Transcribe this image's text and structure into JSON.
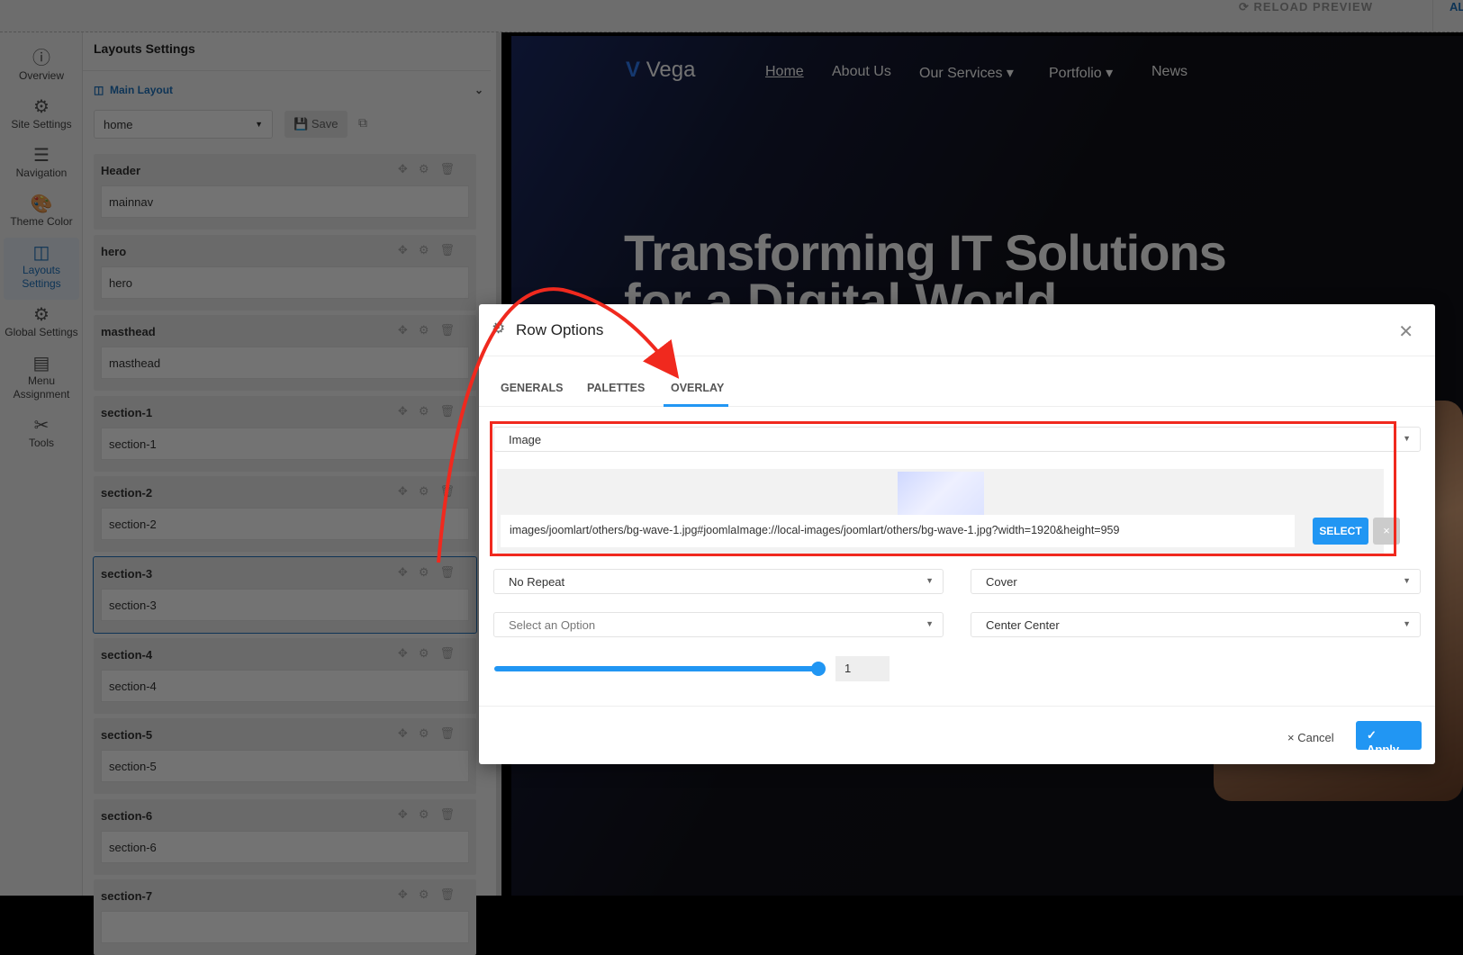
{
  "topbar": {
    "reload": "RELOAD PREVIEW",
    "right_link": "AL"
  },
  "nav": [
    {
      "icon": "info-icon",
      "glyph": "ⓘ",
      "label": "Overview"
    },
    {
      "icon": "gear-icon",
      "glyph": "⚙",
      "label": "Site Settings"
    },
    {
      "icon": "menu-icon",
      "glyph": "☰",
      "label": "Navigation"
    },
    {
      "icon": "palette-icon",
      "glyph": "🎨",
      "label": "Theme Color"
    },
    {
      "icon": "layout-icon",
      "glyph": "◫",
      "label": "Layouts Settings"
    },
    {
      "icon": "gears-icon",
      "glyph": "⚙",
      "label": "Global Settings"
    },
    {
      "icon": "list-icon",
      "glyph": "▤",
      "label": "Menu Assignment"
    },
    {
      "icon": "tools-icon",
      "glyph": "✂",
      "label": "Tools"
    }
  ],
  "panel": {
    "title": "Layouts Settings",
    "layout_name": "Main Layout",
    "layout_select": "home",
    "save": "Save",
    "blocks": [
      {
        "name": "Header",
        "value": "mainnav"
      },
      {
        "name": "hero",
        "value": "hero"
      },
      {
        "name": "masthead",
        "value": "masthead"
      },
      {
        "name": "section-1",
        "value": "section-1"
      },
      {
        "name": "section-2",
        "value": "section-2"
      },
      {
        "name": "section-3",
        "value": "section-3"
      },
      {
        "name": "section-4",
        "value": "section-4"
      },
      {
        "name": "section-5",
        "value": "section-5"
      },
      {
        "name": "section-6",
        "value": "section-6"
      },
      {
        "name": "section-7",
        "value": ""
      }
    ]
  },
  "preview": {
    "logo": "Vega",
    "nav": [
      "Home",
      "About Us",
      "Our Services ▾",
      "Portfolio ▾",
      "News"
    ],
    "hero_line1": "Transforming IT Solutions",
    "hero_line2": "for a Digital World"
  },
  "modal": {
    "title": "Row Options",
    "tabs": [
      "GENERALS",
      "PALETTES",
      "OVERLAY"
    ],
    "active_tab": "OVERLAY",
    "overlay_type": "Image",
    "image_path": "images/joomlart/others/bg-wave-1.jpg#joomlaImage://local-images/joomlart/others/bg-wave-1.jpg?width=1920&height=959",
    "select_btn": "SELECT",
    "clear_btn": "×",
    "repeat": "No Repeat",
    "size": "Cover",
    "attachment_placeholder": "Select an Option",
    "position": "Center Center",
    "opacity": "1",
    "cancel": "× Cancel",
    "apply": "✓ Apply"
  },
  "colors": {
    "accent": "#2196f3",
    "annotation": "#f0291e"
  }
}
